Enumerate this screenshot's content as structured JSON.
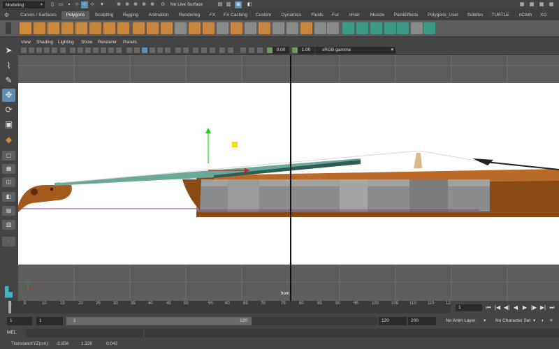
{
  "status_line": {
    "mode": "Modeling",
    "live_surface": "No Live Surface"
  },
  "shelf": {
    "tabs": [
      {
        "label": "Curves / Surfaces"
      },
      {
        "label": "Polygons",
        "active": true
      },
      {
        "label": "Sculpting"
      },
      {
        "label": "Rigging"
      },
      {
        "label": "Animation"
      },
      {
        "label": "Rendering"
      },
      {
        "label": "FX"
      },
      {
        "label": "FX Caching"
      },
      {
        "label": "Custom"
      },
      {
        "label": "Dynamics"
      },
      {
        "label": "Fluids"
      },
      {
        "label": "Fur"
      },
      {
        "label": "nHair"
      },
      {
        "label": "Muscle"
      },
      {
        "label": "PaintEffects"
      },
      {
        "label": "Polygons_User"
      },
      {
        "label": "Subdivs"
      },
      {
        "label": "TURTLE"
      },
      {
        "label": "nCloth"
      },
      {
        "label": "XG"
      }
    ]
  },
  "panel": {
    "menus": [
      "View",
      "Shading",
      "Lighting",
      "Show",
      "Renderer",
      "Panels"
    ],
    "near_clip": "0.00",
    "far_clip": "1.00",
    "color_space": "sRGB gamma"
  },
  "viewport": {
    "camera_label": "from"
  },
  "timeline": {
    "ticks": [
      "1",
      "5",
      "10",
      "15",
      "20",
      "25",
      "30",
      "35",
      "40",
      "45",
      "50",
      "55",
      "60",
      "65",
      "70",
      "75",
      "80",
      "85",
      "90",
      "95",
      "100",
      "105",
      "110",
      "115",
      "12"
    ],
    "current_frame": "1"
  },
  "range": {
    "start": "1",
    "playback_start": "1",
    "slider_start": "1",
    "slider_end": "120",
    "playback_end": "120",
    "end": "200",
    "anim_layer": "No Anim Layer",
    "character_set": "No Character Set"
  },
  "command_line": {
    "label": "MEL"
  },
  "help_line": {
    "label": "TranslateXYZ(cm):",
    "x": "-2.856",
    "y": "1.330",
    "z": "0.042"
  },
  "colors": {
    "accent": "#5c8fb5",
    "shelf_bg": "#5d5d5d",
    "ui_bg": "#444444"
  }
}
